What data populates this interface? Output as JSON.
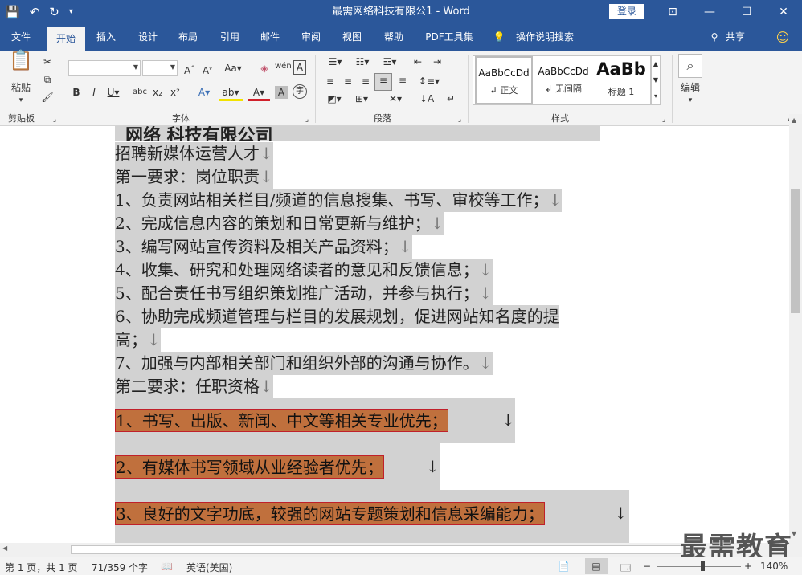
{
  "titlebar": {
    "title": "最需网络科技有限公1  -  Word",
    "login": "登录",
    "qat_icons": [
      "save-icon",
      "undo-icon",
      "redo-icon",
      "customize-icon"
    ],
    "controls": [
      "ribbon-display-icon",
      "minimize-icon",
      "maximize-icon",
      "close-icon"
    ]
  },
  "tabs": [
    "文件",
    "开始",
    "插入",
    "设计",
    "布局",
    "引用",
    "邮件",
    "审阅",
    "视图",
    "帮助",
    "PDF工具集",
    "操作说明搜索"
  ],
  "share": "共享",
  "ribbon": {
    "clipboard": {
      "paste": "粘贴",
      "label": "剪贴板"
    },
    "font": {
      "label": "字体",
      "font_name": "",
      "font_size": ""
    },
    "paragraph": {
      "label": "段落"
    },
    "styles": {
      "label": "样式",
      "items": [
        {
          "sample": "AaBbCcDd",
          "name": "↲ 正文"
        },
        {
          "sample": "AaBbCcDd",
          "name": "↲ 无间隔"
        },
        {
          "sample": "AaBb",
          "name": "标题 1"
        }
      ]
    },
    "editing": {
      "label": "编辑"
    }
  },
  "document": {
    "partial_top": "网络  科技有限公司",
    "lines": [
      "招聘新媒体运营人才",
      "第一要求：岗位职责",
      "1、负责网站相关栏目/频道的信息搜集、书写、审校等工作；",
      "2、完成信息内容的策划和日常更新与维护；",
      "3、编写网站宣传资料及相关产品资料；",
      "4、收集、研究和处理网络读者的意见和反馈信息；",
      "5、配合责任书写组织策划推广活动，并参与执行；",
      "6、协助完成频道管理与栏目的发展规划，促进网站知名度的提",
      "高；",
      "7、加强与内部相关部门和组织外部的沟通与协作。",
      "第二要求：任职资格"
    ],
    "highlighted": [
      "1、书写、出版、新闻、中文等相关专业优先；",
      "2、有媒体书写领域从业经验者优先；",
      "3、良好的文字功底，较强的网站专题策划和信息采编能力；"
    ],
    "para_mark": "↓"
  },
  "status": {
    "page": "第 1 页，共 1 页",
    "words": "71/359 个字",
    "language": "英语(美国)",
    "zoom": "140%"
  },
  "watermark": "最需教育"
}
